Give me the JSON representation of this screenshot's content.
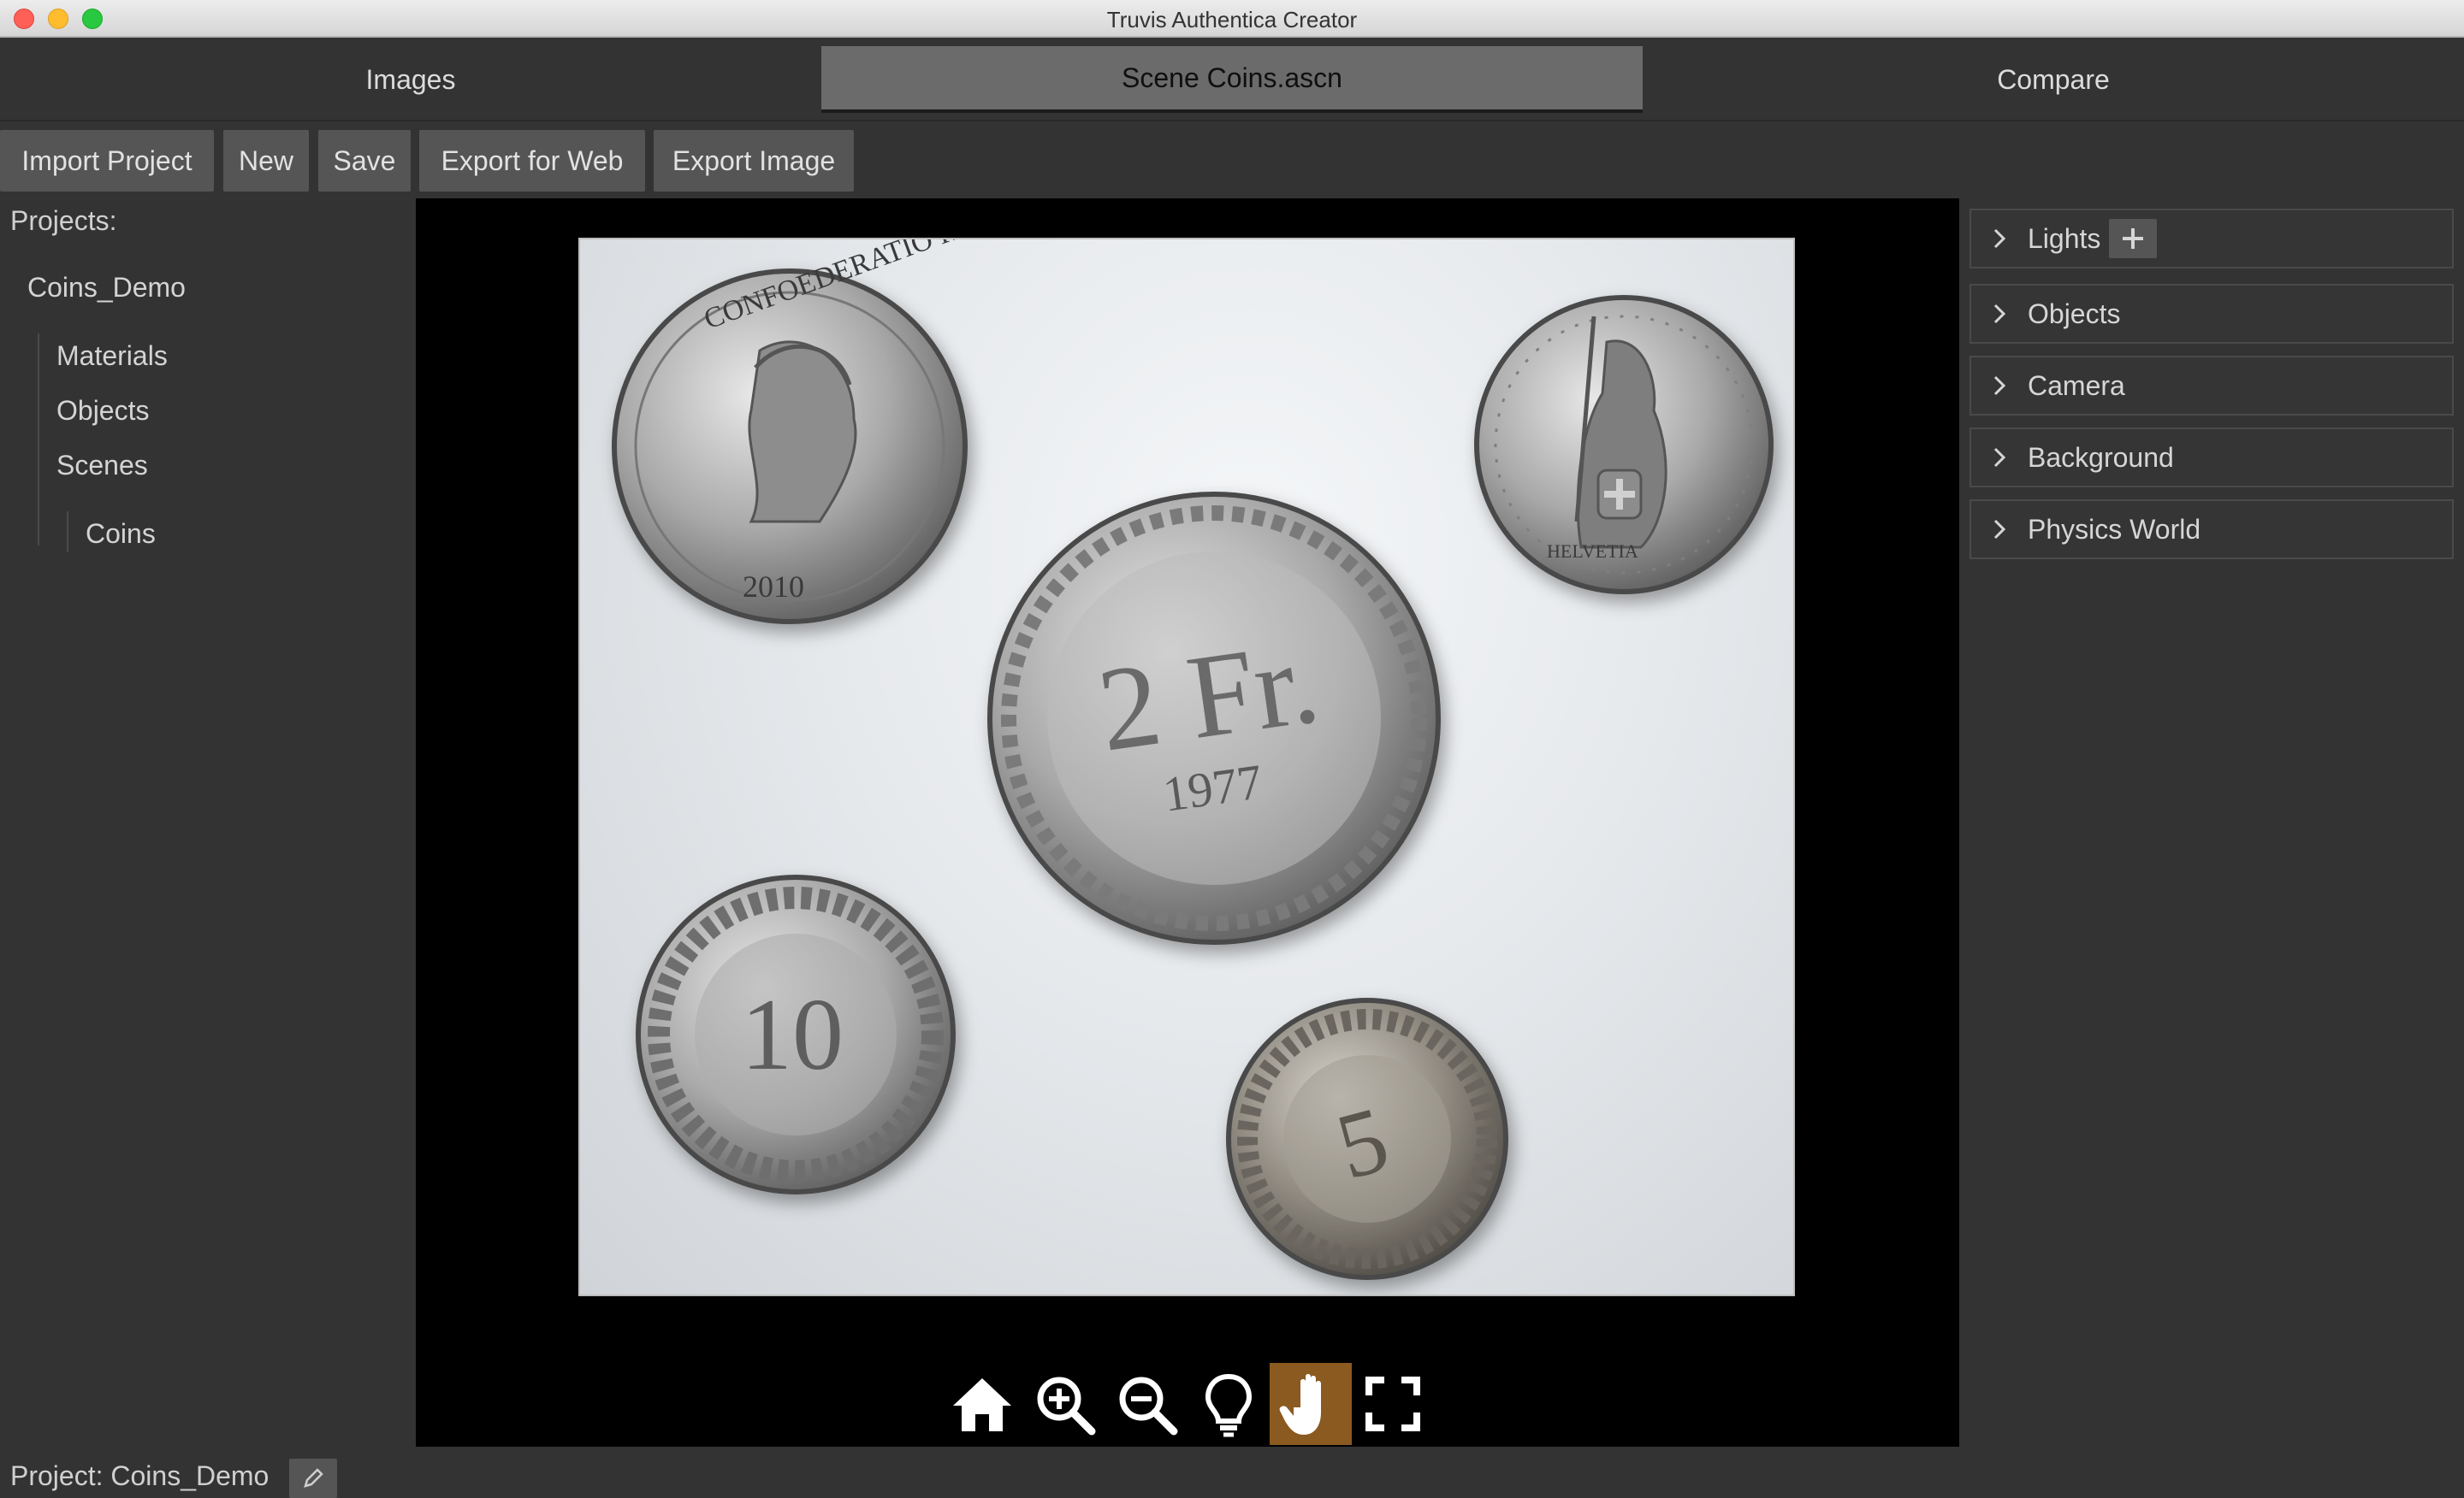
{
  "window": {
    "title": "Truvis Authentica Creator"
  },
  "tabs": [
    {
      "label": "Images"
    },
    {
      "label": "Scene Coins.ascn"
    },
    {
      "label": "Compare"
    }
  ],
  "toolbar": {
    "import_label": "Import Project",
    "new_label": "New",
    "save_label": "Save",
    "export_web_label": "Export for Web",
    "export_image_label": "Export Image"
  },
  "sidebar": {
    "projects_label": "Projects:",
    "tree": {
      "root": "Coins_Demo",
      "materials": "Materials",
      "objects": "Objects",
      "scenes": "Scenes",
      "coins": "Coins"
    }
  },
  "status": {
    "project_label": "Project: Coins_Demo"
  },
  "viewport": {
    "toolbar_icons": [
      "home-icon",
      "zoom-in-icon",
      "zoom-out-icon",
      "lightbulb-icon",
      "hand-icon",
      "fullscreen-icon"
    ],
    "active_tool": "hand-icon",
    "active_color": "#8a5a20"
  },
  "coins": {
    "c1_top": "CONFOEDERATIO HELVETICA",
    "c1_year": "2010",
    "c2_value": "2 Fr.",
    "c2_year": "1977",
    "c3_text": "HELVETIA",
    "c4_value": "10",
    "c5_value": "5"
  },
  "right_panel": {
    "sections": [
      {
        "label": "Lights"
      },
      {
        "label": "Objects"
      },
      {
        "label": "Camera"
      },
      {
        "label": "Background"
      },
      {
        "label": "Physics World"
      }
    ]
  }
}
